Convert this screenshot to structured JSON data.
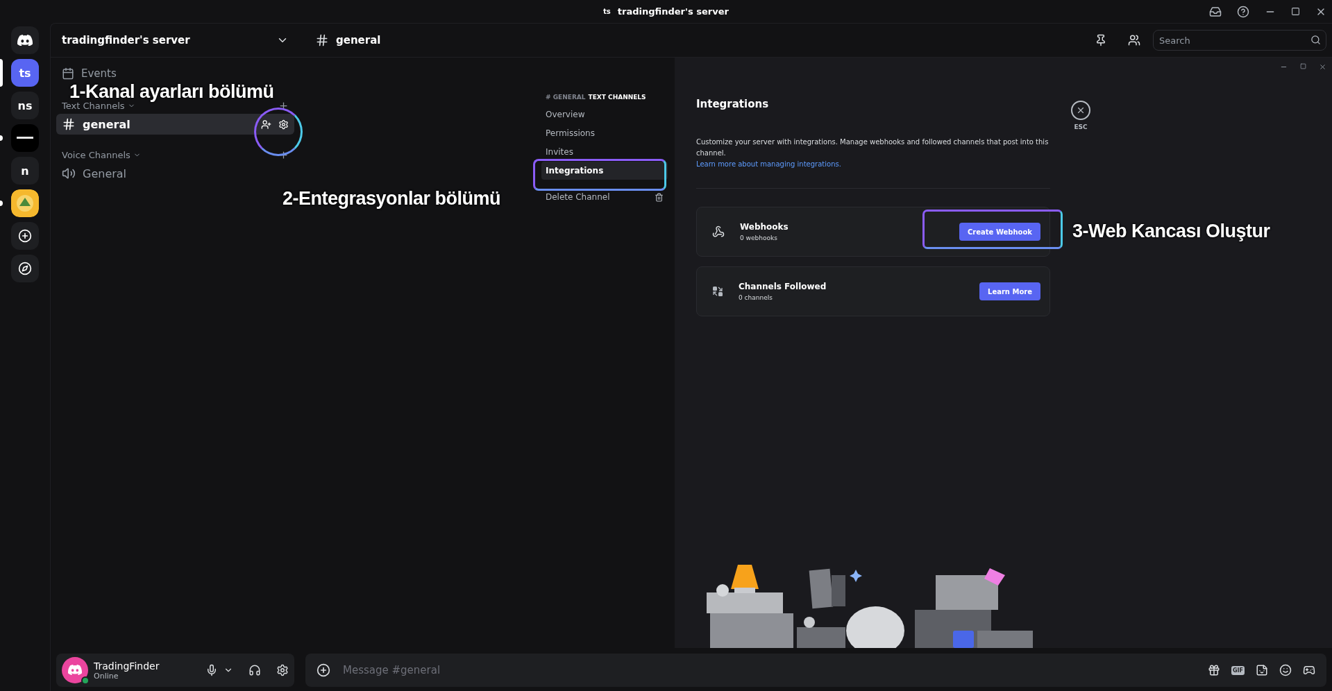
{
  "title_bar": {
    "badge": "ts",
    "title": "tradingfinder's server"
  },
  "servers": [
    {
      "kind": "home",
      "selected": false,
      "unread": false
    },
    {
      "kind": "text",
      "label": "ts",
      "selected": true
    },
    {
      "kind": "text",
      "label": "ns",
      "selected": false,
      "unread": false
    },
    {
      "kind": "image",
      "selected": false,
      "unread": true
    },
    {
      "kind": "text",
      "label": "n",
      "selected": false,
      "unread": false
    },
    {
      "kind": "image",
      "selected": false,
      "unread": true
    },
    {
      "kind": "add",
      "selected": false,
      "unread": false
    },
    {
      "kind": "discover",
      "selected": false,
      "unread": false
    }
  ],
  "sidebar": {
    "server_name": "tradingfinder's server",
    "events": "Events",
    "categories": [
      {
        "name": "Text Channels",
        "kind": "text",
        "channels": [
          {
            "name": "general",
            "selected": true
          }
        ]
      },
      {
        "name": "Voice Channels",
        "kind": "voice",
        "channels": [
          {
            "name": "General",
            "selected": false
          }
        ]
      }
    ]
  },
  "user": {
    "name": "TradingFinder",
    "status": "Online"
  },
  "header": {
    "channel": "general",
    "search_placeholder": "Search"
  },
  "settings": {
    "section_channel": "# GENERAL",
    "section_type": "TEXT CHANNELS",
    "items": [
      {
        "label": "Overview",
        "kind": "normal",
        "selected": false
      },
      {
        "label": "Permissions",
        "kind": "normal",
        "selected": false
      },
      {
        "label": "Invites",
        "kind": "normal",
        "selected": false
      },
      {
        "label": "Integrations",
        "kind": "normal",
        "selected": true
      },
      {
        "label": "Delete Channel",
        "kind": "danger",
        "selected": false
      }
    ],
    "title": "Integrations",
    "description": "Customize your server with integrations. Manage webhooks and followed channels that post into this channel.",
    "link": "Learn more about managing integrations.",
    "close_label": "ESC",
    "cards": [
      {
        "kind": "webhooks",
        "title": "Webhooks",
        "subtitle": "0 webhooks",
        "button": "Create Webhook"
      },
      {
        "kind": "followed",
        "title": "Channels Followed",
        "subtitle": "0 channels",
        "button": "Learn More"
      }
    ]
  },
  "composer": {
    "placeholder": "Message #general",
    "gif_label": "GIF"
  },
  "annotations": [
    "1-Kanal ayarları bölümü",
    "2-Entegrasyonlar bölümü",
    "3-Web Kancası Oluştur"
  ]
}
